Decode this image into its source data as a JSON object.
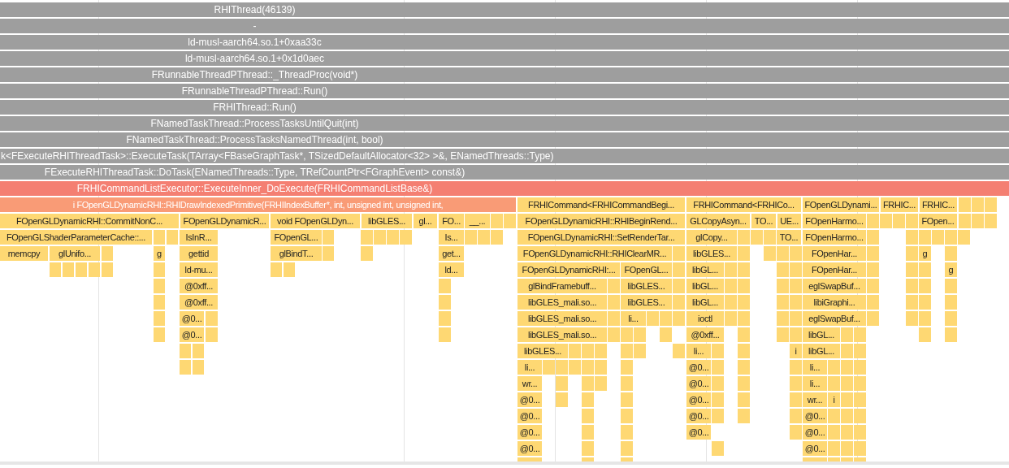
{
  "flame_graph": {
    "rows": [
      {
        "frames": [
          {
            "label": "RHIThread(46139)",
            "color": "#9e9e9e"
          }
        ]
      },
      {
        "frames": [
          {
            "label": "-",
            "color": "#9e9e9e"
          }
        ]
      },
      {
        "frames": [
          {
            "label": "ld-musl-aarch64.so.1+0xaa33c",
            "color": "#9e9e9e"
          }
        ]
      },
      {
        "frames": [
          {
            "label": "ld-musl-aarch64.so.1+0x1d0aec",
            "color": "#9e9e9e"
          }
        ]
      },
      {
        "frames": [
          {
            "label": "FRunnableThreadPThread::_ThreadProc(void*)",
            "color": "#9e9e9e"
          }
        ]
      },
      {
        "frames": [
          {
            "label": "FRunnableThreadPThread::Run()",
            "color": "#9e9e9e"
          }
        ]
      },
      {
        "frames": [
          {
            "label": "FRHIThread::Run()",
            "color": "#9e9e9e"
          }
        ]
      },
      {
        "frames": [
          {
            "label": "FNamedTaskThread::ProcessTasksUntilQuit(int)",
            "color": "#9e9e9e"
          }
        ]
      },
      {
        "frames": [
          {
            "label": "FNamedTaskThread::ProcessTasksNamedThread(int, bool)",
            "color": "#9e9e9e"
          }
        ]
      },
      {
        "frames": [
          {
            "label": "k<FExecuteRHIThreadTask>::ExecuteTask(TArray<FBaseGraphTask*, TSizedDefaultAllocator<32> >&, ENamedThreads::Type)",
            "color": "#9e9e9e"
          }
        ]
      },
      {
        "frames": [
          {
            "label": "FExecuteRHIThreadTask::DoTask(ENamedThreads::Type, TRefCountPtr<FGraphEvent> const&)",
            "color": "#9e9e9e"
          }
        ]
      },
      {
        "frames": [
          {
            "label": "FRHICommandListExecutor::ExecuteInner_DoExecute(FRHICommandListBase&)",
            "color": "#f47f72"
          }
        ]
      },
      {
        "frames": [
          {
            "label": "i FOpenGLDynamicRHI::RHIDrawIndexedPrimitive(FRHIIndexBuffer*, int, unsigned int, unsigned int,",
            "color": "#f99b76"
          },
          {
            "label": "FRHICommand<FRHICommandBegi...",
            "color": "#fed873"
          },
          {
            "label": "FRHICommand<FRHICo...",
            "color": "#fed873"
          },
          {
            "label": "FOpenGLDynami...",
            "color": "#fed873"
          },
          {
            "label": "FRHIC...",
            "color": "#fed873"
          },
          {
            "label": "FRHIC...",
            "color": "#fed873"
          }
        ]
      },
      {
        "frames": [
          {
            "label": "FOpenGLDynamicRHI::CommitNonC...",
            "color": "#fed873"
          },
          {
            "label": "FOpenGLDynamicR...",
            "color": "#fed873"
          },
          {
            "label": "void FOpenGLDyn...",
            "color": "#fed873"
          },
          {
            "label": "libGLES...",
            "color": "#fed873"
          },
          {
            "label": "gl...",
            "color": "#fed873"
          },
          {
            "label": "FO...",
            "color": "#fed873"
          },
          {
            "label": "__...",
            "color": "#fed873"
          },
          {
            "label": "FOpenGLDynamicRHI::RHIBeginRend...",
            "color": "#fed873"
          },
          {
            "label": "GLCopyAsyn...",
            "color": "#fed873"
          },
          {
            "label": "TO...",
            "color": "#fed873"
          },
          {
            "label": "UE...",
            "color": "#fed873"
          },
          {
            "label": "FOpenHarmo...",
            "color": "#fed873"
          },
          {
            "label": "FOpen...",
            "color": "#fed873"
          }
        ]
      },
      {
        "frames": [
          {
            "label": "FOpenGLShaderParameterCache::...",
            "color": "#fed873"
          },
          {
            "label": "IsInR...",
            "color": "#fed873"
          },
          {
            "label": "FOpenGL...",
            "color": "#fed873"
          },
          {
            "label": "Is...",
            "color": "#fed873"
          },
          {
            "label": "FOpenGLDynamicRHI::SetRenderTar...",
            "color": "#fed873"
          },
          {
            "label": "glCopy...",
            "color": "#fed873"
          },
          {
            "label": "TO...",
            "color": "#fed873"
          },
          {
            "label": "FOpenHarmo...",
            "color": "#fed873"
          }
        ]
      },
      {
        "frames": [
          {
            "label": "memcpy",
            "color": "#fed873"
          },
          {
            "label": "glUnifo...",
            "color": "#fed873"
          },
          {
            "label": "g",
            "color": "#fed873"
          },
          {
            "label": "gettid",
            "color": "#fed873"
          },
          {
            "label": "glBindT...",
            "color": "#fed873"
          },
          {
            "label": "get...",
            "color": "#fed873"
          },
          {
            "label": "FOpenGLDynamicRHI::RHIClearMR...",
            "color": "#fed873"
          },
          {
            "label": "libGLES...",
            "color": "#fed873"
          },
          {
            "label": "FOpenHar...",
            "color": "#fed873"
          },
          {
            "label": "g",
            "color": "#fed873"
          }
        ]
      },
      {
        "frames": [
          {
            "label": "ld-mu...",
            "color": "#fed873"
          },
          {
            "label": "ld...",
            "color": "#fed873"
          },
          {
            "label": "FOpenGLDynamicRHI:...",
            "color": "#fed873"
          },
          {
            "label": "FOpenGL...",
            "color": "#fed873"
          },
          {
            "label": "libGL...",
            "color": "#fed873"
          },
          {
            "label": "FOpenHar...",
            "color": "#fed873"
          },
          {
            "label": "g",
            "color": "#fed873"
          }
        ]
      },
      {
        "frames": [
          {
            "label": "@0xff...",
            "color": "#fed873"
          },
          {
            "label": "glBindFramebuff...",
            "color": "#fed873"
          },
          {
            "label": "libGLES...",
            "color": "#fed873"
          },
          {
            "label": "libGL...",
            "color": "#fed873"
          },
          {
            "label": "eglSwapBuf...",
            "color": "#fed873"
          }
        ]
      },
      {
        "frames": [
          {
            "label": "@0xff...",
            "color": "#fed873"
          },
          {
            "label": "libGLES_mali.so...",
            "color": "#fed873"
          },
          {
            "label": "libGLES...",
            "color": "#fed873"
          },
          {
            "label": "libGL...",
            "color": "#fed873"
          },
          {
            "label": "libiGraphi...",
            "color": "#fed873"
          }
        ]
      },
      {
        "frames": [
          {
            "label": "@0...",
            "color": "#fed873"
          },
          {
            "label": "libGLES_mali.so...",
            "color": "#fed873"
          },
          {
            "label": "li...",
            "color": "#fed873"
          },
          {
            "label": "ioctl",
            "color": "#fed873"
          },
          {
            "label": "eglSwapBuf...",
            "color": "#fed873"
          }
        ]
      },
      {
        "frames": [
          {
            "label": "@0...",
            "color": "#fed873"
          },
          {
            "label": "libGLES_mali.so...",
            "color": "#fed873"
          },
          {
            "label": "@0xff...",
            "color": "#fed873"
          },
          {
            "label": "libGL...",
            "color": "#fed873"
          }
        ]
      },
      {
        "frames": [
          {
            "label": "libGLES...",
            "color": "#fed873"
          },
          {
            "label": "li...",
            "color": "#fed873"
          },
          {
            "label": "i",
            "color": "#fed873"
          },
          {
            "label": "libGL...",
            "color": "#fed873"
          }
        ]
      },
      {
        "frames": [
          {
            "label": "li...",
            "color": "#fed873"
          },
          {
            "label": "@0...",
            "color": "#fed873"
          },
          {
            "label": "li...",
            "color": "#fed873"
          }
        ]
      },
      {
        "frames": [
          {
            "label": "wr...",
            "color": "#fed873"
          },
          {
            "label": "@0...",
            "color": "#fed873"
          },
          {
            "label": "li...",
            "color": "#fed873"
          }
        ]
      },
      {
        "frames": [
          {
            "label": "@0...",
            "color": "#fed873"
          },
          {
            "label": "@0...",
            "color": "#fed873"
          },
          {
            "label": "wr...",
            "color": "#fed873"
          },
          {
            "label": "i",
            "color": "#fed873"
          }
        ]
      },
      {
        "frames": [
          {
            "label": "@0...",
            "color": "#fed873"
          },
          {
            "label": "@0...",
            "color": "#fed873"
          },
          {
            "label": "@0...",
            "color": "#fed873"
          }
        ]
      },
      {
        "frames": [
          {
            "label": "@0...",
            "color": "#fed873"
          },
          {
            "label": "@0...",
            "color": "#fed873"
          },
          {
            "label": "@0...",
            "color": "#fed873"
          }
        ]
      },
      {
        "frames": [
          {
            "label": "@0...",
            "color": "#fed873"
          },
          {
            "label": "@0...",
            "color": "#fed873"
          }
        ]
      }
    ]
  }
}
